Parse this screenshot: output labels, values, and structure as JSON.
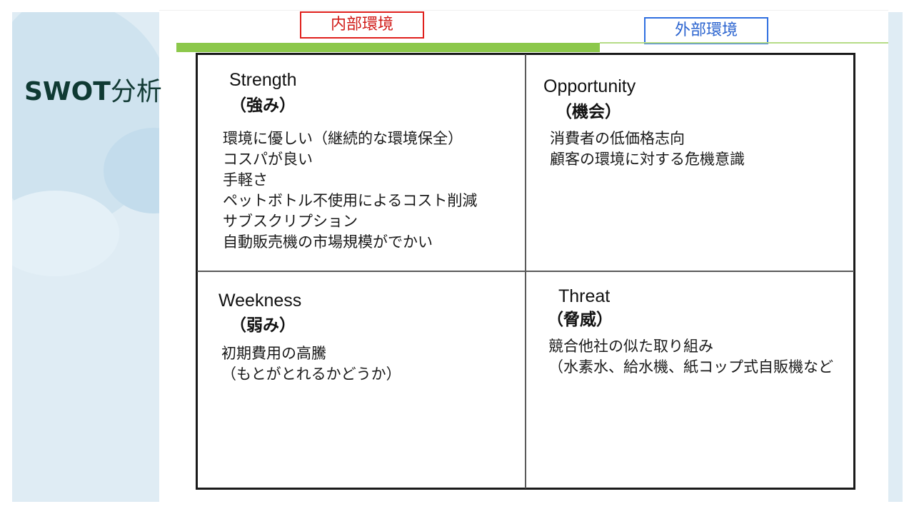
{
  "slide": {
    "title_en": "SWOT",
    "title_jp": "分析"
  },
  "header": {
    "internal_label": "内部環境",
    "external_label": "外部環境"
  },
  "colors": {
    "title": "#0f3a33",
    "internal_border": "#e0201c",
    "external_border": "#2f6fe0",
    "green_bar": "#8cc84b",
    "panel_bg": "#dfecf4"
  },
  "quadrants": {
    "strength": {
      "title_en": "Strength",
      "title_jp": "（強み）",
      "items": [
        "環境に優しい（継続的な環境保全）",
        "コスパが良い",
        "手軽さ",
        "ペットボトル不使用によるコスト削減",
        "サブスクリプション",
        "自動販売機の市場規模がでかい"
      ]
    },
    "opportunity": {
      "title_en": "Opportunity",
      "title_jp": "（機会）",
      "items": [
        "消費者の低価格志向",
        "顧客の環境に対する危機意識"
      ]
    },
    "weakness": {
      "title_en": "Weekness",
      "title_jp": "（弱み）",
      "items": [
        "初期費用の高騰",
        "（もとがとれるかどうか）"
      ]
    },
    "threat": {
      "title_en": "Threat",
      "title_jp": "（脅威）",
      "items": [
        "競合他社の似た取り組み",
        "（水素水、給水機、紙コップ式自販機など"
      ]
    }
  }
}
